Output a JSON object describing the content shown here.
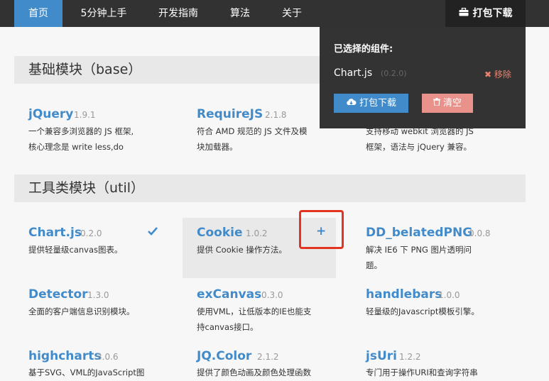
{
  "nav": {
    "items": [
      "首页",
      "5分钟上手",
      "开发指南",
      "算法",
      "关于"
    ],
    "download_label": "打包下载",
    "download_icon": "briefcase-icon"
  },
  "panel": {
    "title": "已选择的组件:",
    "selected": [
      {
        "name": "Chart.js",
        "version": "(0.2.0)",
        "remove_label": "移除"
      }
    ],
    "download_label": "打包下载",
    "clear_label": "清空"
  },
  "sections": [
    {
      "title": "基础模块（base）",
      "modules": [
        {
          "name": "jQuery",
          "version": "1.9.1",
          "desc": [
            "一个兼容多浏览器的 JS 框架,",
            "核心理念是 write less,do"
          ]
        },
        {
          "name": "RequireJS",
          "version": "2.1.8",
          "desc": [
            "符合 AMD 规范的 JS 文件及模",
            "块加载器。"
          ]
        },
        {
          "name": "",
          "version": "",
          "desc": [
            "支持移动 webkit 浏览器的 JS",
            "框架，语法与 jQuery 兼容。"
          ]
        }
      ]
    },
    {
      "title": "工具类模块（util）",
      "modules": [
        {
          "name": "Chart.js",
          "version": "0.2.0",
          "desc": [
            "提供轻量级canvas图表。"
          ],
          "selected": true
        },
        {
          "name": "Cookie",
          "version": "1.0.2",
          "desc": [
            "提供 Cookie 操作方法。"
          ],
          "add_label": "+"
        },
        {
          "name": "DD_belatedPNG",
          "version": "0.0.8",
          "desc": [
            "解决 IE6 下 PNG 图片透明问",
            "题。"
          ]
        },
        {
          "name": "Detector",
          "version": "1.3.0",
          "desc": [
            "全面的客户端信息识别模块。"
          ]
        },
        {
          "name": "exCanvas",
          "version": "0.3.0",
          "desc": [
            "使用VML，让低版本的IE也能支",
            "持canvas接口。"
          ]
        },
        {
          "name": "handlebars",
          "version": "1.0.0",
          "desc": [
            "轻量级的Javascript模板引擎。"
          ]
        },
        {
          "name": "highcharts",
          "version": "3.0.6",
          "desc": [
            "基于SVG、VML的JavaScript图"
          ]
        },
        {
          "name": "JQ.Color",
          "version": "2.1.2",
          "desc": [
            "提供了颜色动画及颜色处理函数"
          ]
        },
        {
          "name": "jsUri",
          "version": "1.2.2",
          "desc": [
            "专门用于操作URI和查询字符串"
          ]
        }
      ]
    }
  ],
  "colors": {
    "nav_bg": "#323232",
    "accent": "#428bca",
    "panel_bg": "#333333",
    "highlight": "#e3341f"
  }
}
